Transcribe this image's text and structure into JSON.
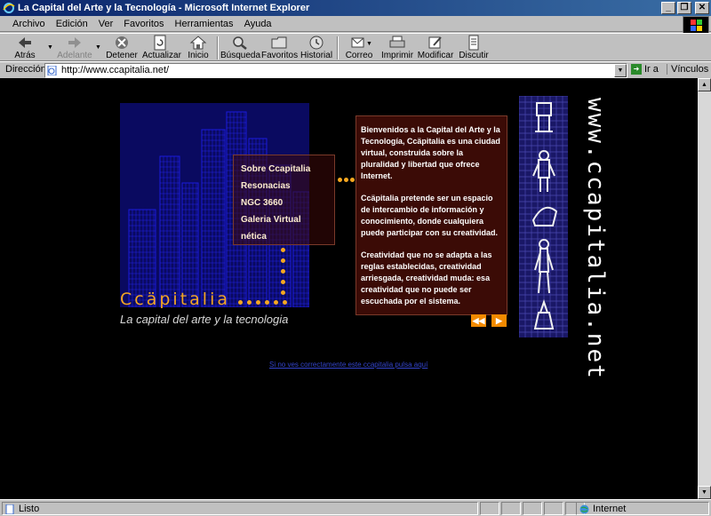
{
  "window": {
    "title": "La Capital del Arte y la Tecnología - Microsoft Internet Explorer",
    "controls": [
      "_",
      "❐",
      "✕"
    ]
  },
  "menu": {
    "items": [
      "Archivo",
      "Edición",
      "Ver",
      "Favoritos",
      "Herramientas",
      "Ayuda"
    ]
  },
  "toolbar": {
    "back": "Atrás",
    "forward": "Adelante",
    "stop": "Detener",
    "refresh": "Actualizar",
    "home": "Inicio",
    "search": "Búsqueda",
    "favorites": "Favoritos",
    "history": "Historial",
    "mail": "Correo",
    "print": "Imprimir",
    "edit": "Modificar",
    "discuss": "Discutir"
  },
  "address": {
    "label": "Dirección",
    "url": "http://www.ccapitalia.net/",
    "go": "Ir a",
    "links": "Vínculos"
  },
  "page": {
    "nav": [
      "Sobre Ccapitalia",
      "Resonacias",
      "NGC 3660",
      "Galeria Virtual",
      "nética"
    ],
    "brand": "Ccäpitalia",
    "tagline": "La capital del arte y la tecnologia",
    "paragraphs": [
      "Bienvenidos a la Capital del Arte y la Tecnología, Ccäpitalia es una ciudad virtual, construida sobre la pluralidad y libertad que ofrece Internet.",
      "Ccäpitalia pretende ser un espacio de intercambio de información y conocimiento, donde cualquiera puede participar con su creatividad.",
      "Creatividad que no se adapta a las reglas establecidas, creatividad arriesgada, creatividad muda: esa creatividad que no puede ser escuchada por el sistema."
    ],
    "prev": "◀◀",
    "next": "▶",
    "vertical_url": "www.ccapitalia.net",
    "bottom_link": "Si no ves correctamente este ccapitalia pulsa aquí"
  },
  "status": {
    "text": "Listo",
    "zone": "Internet"
  },
  "colors": {
    "accent_orange": "#f4a623",
    "panel_bg": "#3b0b06",
    "city_blue": "#1b1bdc"
  }
}
